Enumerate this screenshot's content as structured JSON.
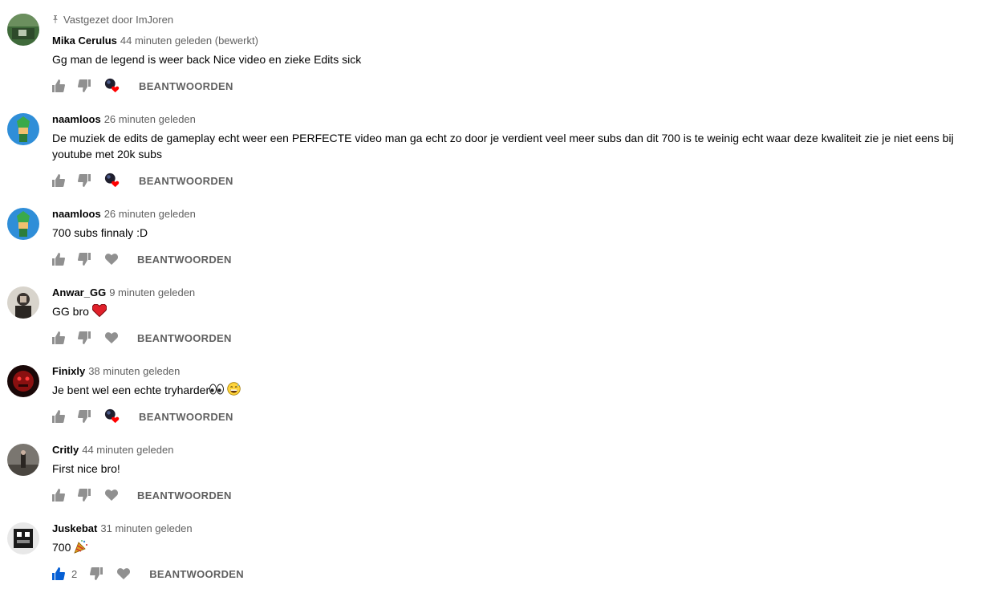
{
  "pinned_label": "Vastgezet door ImJoren",
  "reply_label": "BEANTWOORDEN",
  "comments": [
    {
      "author": "Mika Cerulus",
      "time": "44 minuten geleden (bewerkt)",
      "text": "Gg man de legend is weer back Nice video en zieke Edits sick",
      "hearted": true,
      "likes": ""
    },
    {
      "author": "naamloos",
      "time": "26 minuten geleden",
      "text": "De muziek de edits de gameplay echt weer een PERFECTE video man ga echt zo door je verdient veel meer subs dan dit 700 is te weinig echt waar deze kwaliteit zie je niet eens bij youtube met 20k subs",
      "hearted": true,
      "likes": ""
    },
    {
      "author": "naamloos",
      "time": "26 minuten geleden",
      "text": "700 subs finnaly :D",
      "hearted": false,
      "likes": ""
    },
    {
      "author": "Anwar_GG",
      "time": "9 minuten geleden",
      "text": "GG bro",
      "hearted": false,
      "likes": ""
    },
    {
      "author": "Finixly",
      "time": "38 minuten geleden",
      "text": "Je bent wel een echte tryharder",
      "hearted": true,
      "likes": ""
    },
    {
      "author": "Critly",
      "time": "44 minuten geleden",
      "text": "First nice bro!",
      "hearted": false,
      "likes": ""
    },
    {
      "author": "Juskebat",
      "time": "31 minuten geleden",
      "text": "700",
      "hearted": false,
      "likes": "2"
    }
  ],
  "colors": {
    "like_active": "#065fd4",
    "icon": "#909090",
    "heart_red": "#ff0000"
  }
}
